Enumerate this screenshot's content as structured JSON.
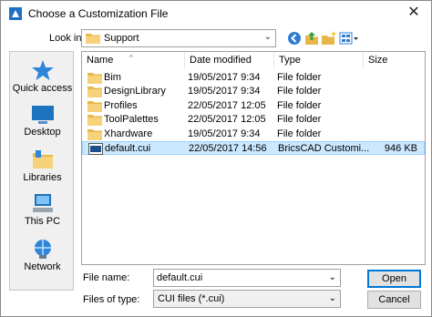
{
  "window": {
    "title": "Choose a Customization File",
    "close_glyph": "✕"
  },
  "toolbar": {
    "look_in_label": "Look in:",
    "look_in_value": "Support",
    "buttons": [
      "back-icon",
      "up-folder-icon",
      "new-folder-icon",
      "view-menu-icon"
    ]
  },
  "places": [
    {
      "label": "Quick access",
      "icon": "star-icon"
    },
    {
      "label": "Desktop",
      "icon": "desktop-icon"
    },
    {
      "label": "Libraries",
      "icon": "libraries-icon"
    },
    {
      "label": "This PC",
      "icon": "computer-icon"
    },
    {
      "label": "Network",
      "icon": "network-icon"
    }
  ],
  "columns": {
    "name": "Name",
    "date": "Date modified",
    "type": "Type",
    "size": "Size"
  },
  "files": [
    {
      "name": "Bim",
      "date": "19/05/2017 9:34",
      "type": "File folder",
      "size": "",
      "kind": "folder"
    },
    {
      "name": "DesignLibrary",
      "date": "19/05/2017 9:34",
      "type": "File folder",
      "size": "",
      "kind": "folder"
    },
    {
      "name": "Profiles",
      "date": "22/05/2017 12:05",
      "type": "File folder",
      "size": "",
      "kind": "folder"
    },
    {
      "name": "ToolPalettes",
      "date": "22/05/2017 12:05",
      "type": "File folder",
      "size": "",
      "kind": "folder"
    },
    {
      "name": "Xhardware",
      "date": "19/05/2017 9:34",
      "type": "File folder",
      "size": "",
      "kind": "folder"
    },
    {
      "name": "default.cui",
      "date": "22/05/2017 14:56",
      "type": "BricsCAD Customi...",
      "size": "946 KB",
      "kind": "cui",
      "selected": true
    }
  ],
  "file_name": {
    "label": "File name:",
    "value": "default.cui"
  },
  "file_type": {
    "label": "Files of type:",
    "value": "CUI files (*.cui)"
  },
  "buttons": {
    "open": "Open",
    "cancel": "Cancel"
  },
  "colors": {
    "selection": "#cce8ff",
    "folder": "#e8b64a",
    "accent": "#0078d7"
  }
}
